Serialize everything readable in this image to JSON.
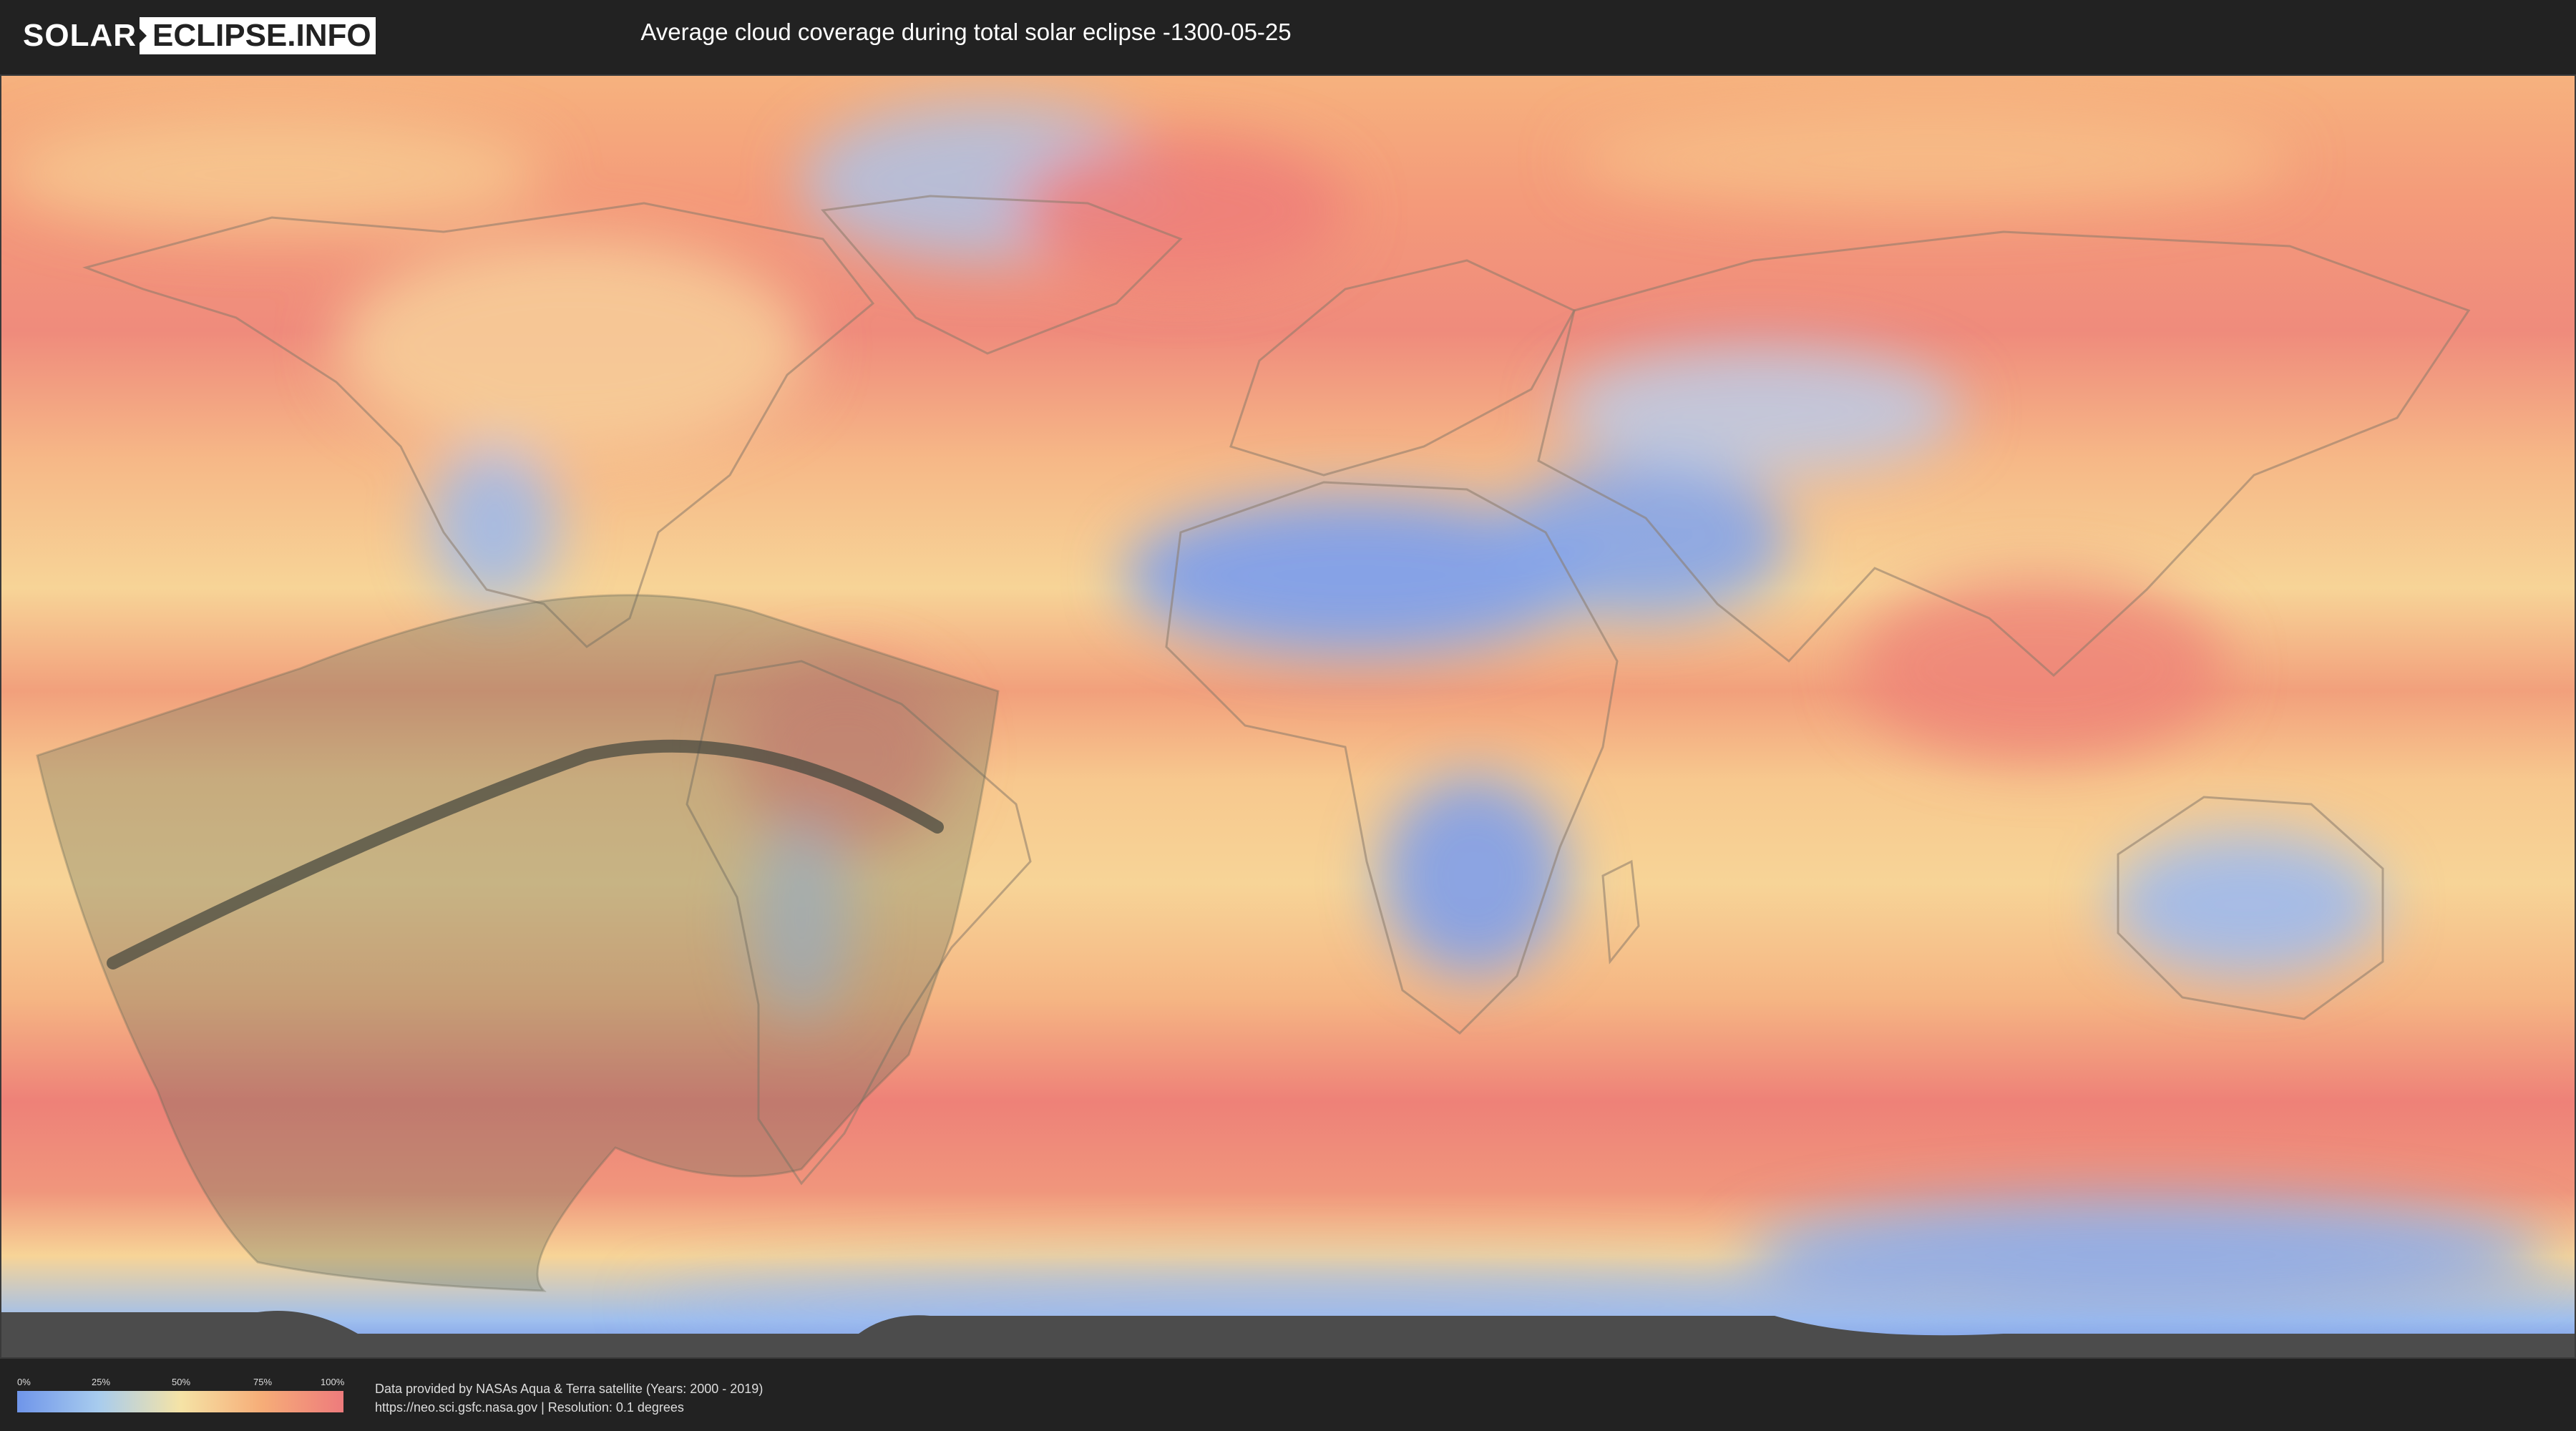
{
  "header": {
    "logo_part1": "SOLAR",
    "logo_part2": "ECLIPSE.INFO",
    "title": "Average cloud coverage during total solar eclipse -1300-05-25"
  },
  "map": {
    "layer": "average cloud coverage",
    "eclipse_overlay": "eclipse visibility region with central line of totality"
  },
  "legend": {
    "ticks": [
      "0%",
      "25%",
      "50%",
      "75%",
      "100%"
    ],
    "colors": [
      "#6f95ea",
      "#a8ccee",
      "#f5e3a6",
      "#f6ad78",
      "#ee7b7c"
    ]
  },
  "footer": {
    "source_line1": "Data provided by NASAs Aqua & Terra satellite (Years: 2000 - 2019)",
    "source_line2": "https://neo.sci.gsfc.nasa.gov | Resolution: 0.1 degrees"
  }
}
